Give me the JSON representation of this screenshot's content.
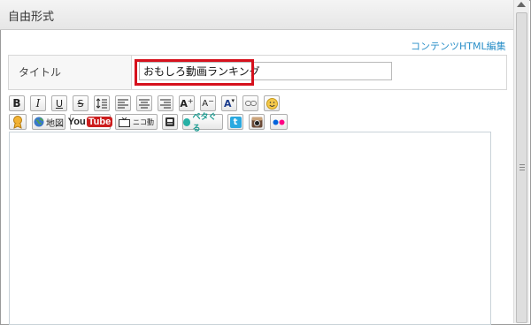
{
  "header": {
    "title": "自由形式"
  },
  "links": {
    "content_html_edit": "コンテンツHTML編集"
  },
  "form": {
    "title_label": "タイトル",
    "title_value": "おもしろ動画ランキング"
  },
  "toolbar": {
    "bold": "B",
    "italic": "I",
    "underline": "U",
    "strike": "S",
    "font_up": "A",
    "font_down": "A",
    "font_color": "A",
    "map": "地図",
    "youtube_you": "You",
    "youtube_tube": "Tube",
    "nico": "ニコ動",
    "petagoru": "ペタぐる",
    "twitter": "t"
  },
  "colors": {
    "link": "#2a8fc8",
    "highlight": "#d6111d",
    "youtube_red": "#cc1d1d",
    "twitter_blue": "#2aa9e0",
    "flickr_pink": "#ff0084",
    "flickr_blue": "#0063dc"
  },
  "icons": {
    "row1": [
      "bold-icon",
      "italic-icon",
      "underline-icon",
      "strikethrough-icon",
      "line-spacing-icon",
      "align-left-icon",
      "align-center-icon",
      "align-right-icon",
      "font-size-up-icon",
      "font-size-down-icon",
      "font-color-icon",
      "link-icon",
      "emoji-icon"
    ],
    "row2": [
      "medal-icon",
      "globe-map-icon",
      "youtube-icon",
      "niconico-icon",
      "book-icon",
      "petagoru-icon",
      "twitter-icon",
      "instagram-icon",
      "flickr-icon"
    ]
  }
}
